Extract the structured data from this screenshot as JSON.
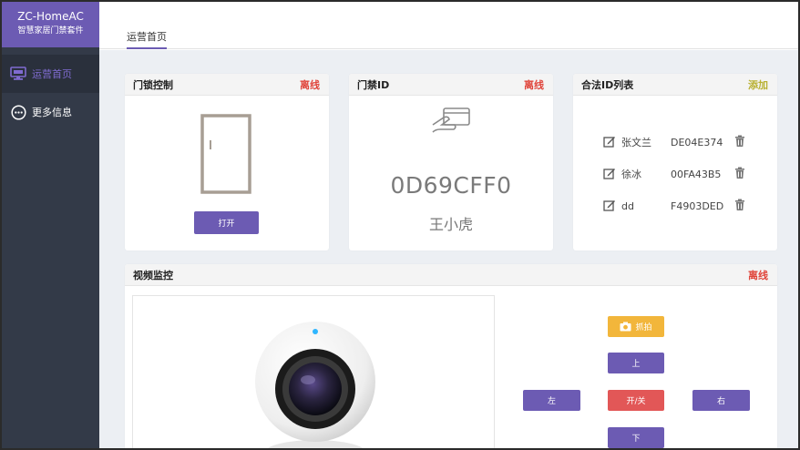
{
  "brand": {
    "title": "ZC-HomeAC",
    "subtitle": "智慧家居门禁套件"
  },
  "sidebar": {
    "items": [
      {
        "label": "运营首页",
        "icon": "monitor-icon",
        "active": true
      },
      {
        "label": "更多信息",
        "icon": "more-circle-icon",
        "active": false
      }
    ]
  },
  "header": {
    "tab": "运营首页"
  },
  "lock_panel": {
    "title": "门锁控制",
    "status": "离线",
    "button": "打开"
  },
  "card_panel": {
    "title": "门禁ID",
    "status": "离线",
    "card_id": "0D69CFF0",
    "owner": "王小虎"
  },
  "id_list": {
    "title": "合法ID列表",
    "action": "添加",
    "rows": [
      {
        "name": "张文兰",
        "id": "DE04E374"
      },
      {
        "name": "徐冰",
        "id": "00FA43B5"
      },
      {
        "name": "dd",
        "id": "F4903DED"
      }
    ]
  },
  "video": {
    "title": "视频监控",
    "status": "离线",
    "controls": {
      "snapshot": "抓拍",
      "up": "上",
      "left": "左",
      "power": "开/关",
      "right": "右",
      "down": "下"
    }
  },
  "colors": {
    "accent": "#6c5bb3",
    "offline": "#e0443a",
    "add": "#b8b032",
    "sidebar": "#333a48"
  }
}
